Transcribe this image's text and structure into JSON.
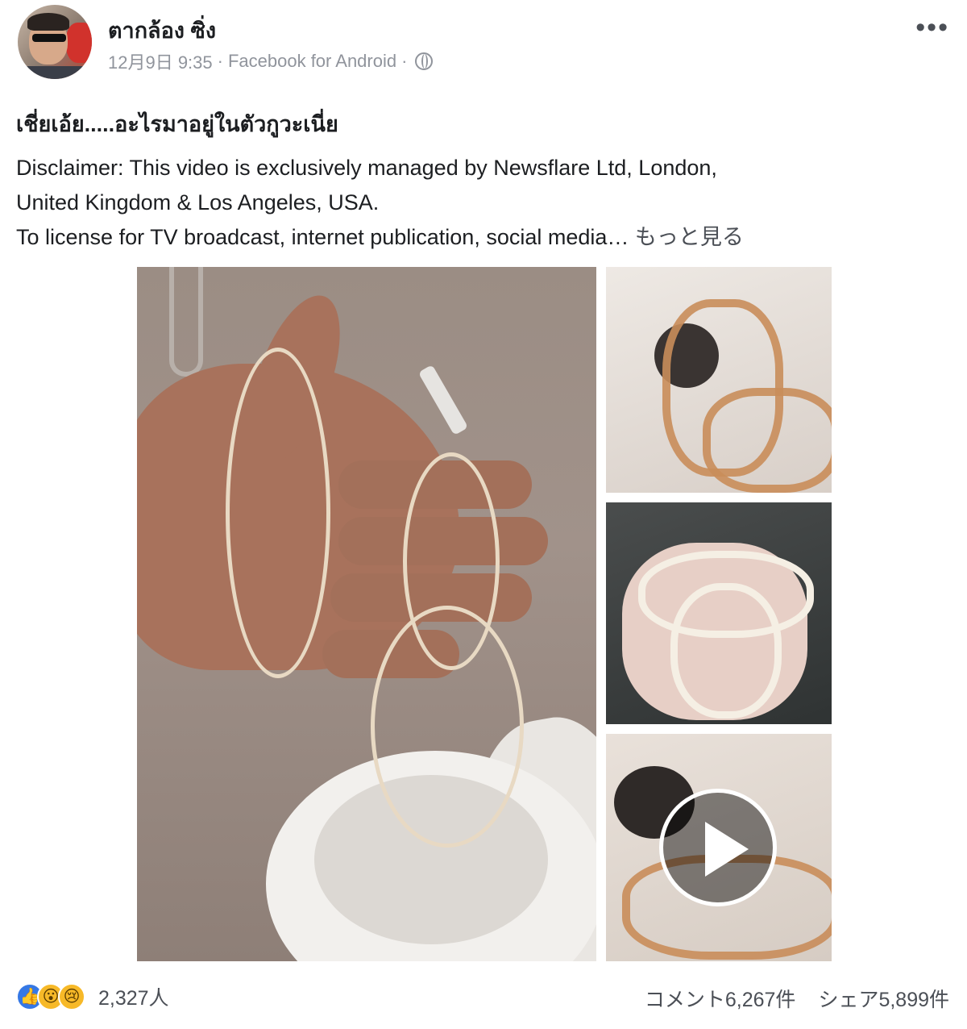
{
  "post": {
    "author": "ตากล้อง ซิ่ง",
    "timestamp": "12月9日 9:35",
    "separator": "·",
    "source": "Facebook for Android",
    "separator2": "·",
    "privacy_icon": "globe-icon",
    "more_label": "•••",
    "headline": "เชี่ยเอ้ย.....อะไรมาอยู่ในตัวกูวะเนี่ย",
    "lines": [
      "Disclaimer: This video is exclusively managed by Newsflare Ltd, London,",
      "United Kingdom & Los Angeles, USA.",
      "To license for TV broadcast, internet publication, social media…"
    ],
    "see_more": "もっと見る"
  },
  "footer": {
    "reaction_icons": [
      "like-icon",
      "wow-icon",
      "sad-icon"
    ],
    "reaction_count": "2,327人",
    "comments": "コメント6,267件",
    "shares": "シェア5,899件"
  },
  "colors": {
    "link": "#4b4f56",
    "meta": "#90949c",
    "like": "#3578e5",
    "emoji": "#f7b928"
  }
}
